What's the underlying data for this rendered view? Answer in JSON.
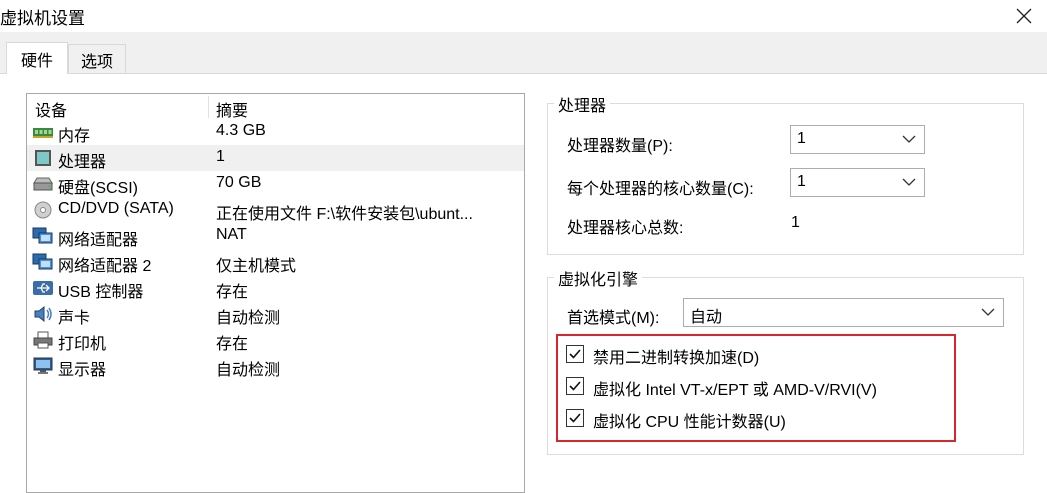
{
  "window": {
    "title": "虚拟机设置"
  },
  "tabs": [
    {
      "label": "硬件"
    },
    {
      "label": "选项"
    }
  ],
  "device_list": {
    "columns": [
      "设备",
      "摘要"
    ],
    "rows": [
      {
        "name": "内存",
        "summary": "4.3 GB",
        "icon": "memory-icon"
      },
      {
        "name": "处理器",
        "summary": "1",
        "icon": "processor-icon"
      },
      {
        "name": "硬盘(SCSI)",
        "summary": "70 GB",
        "icon": "hard-disk-icon"
      },
      {
        "name": "CD/DVD (SATA)",
        "summary": "正在使用文件 F:\\软件安装包\\ubunt...",
        "icon": "cd-dvd-icon"
      },
      {
        "name": "网络适配器",
        "summary": "NAT",
        "icon": "network-adapter-icon"
      },
      {
        "name": "网络适配器 2",
        "summary": "仅主机模式",
        "icon": "network-adapter-icon"
      },
      {
        "name": "USB 控制器",
        "summary": "存在",
        "icon": "usb-icon"
      },
      {
        "name": "声卡",
        "summary": "自动检测",
        "icon": "sound-card-icon"
      },
      {
        "name": "打印机",
        "summary": "存在",
        "icon": "printer-icon"
      },
      {
        "name": "显示器",
        "summary": "自动检测",
        "icon": "display-icon"
      }
    ],
    "selected_index": 1
  },
  "processor_group": {
    "title": "处理器",
    "num_processors_label": "处理器数量(P):",
    "num_processors_value": "1",
    "cores_label": "每个处理器的核心数量(C):",
    "cores_value": "1",
    "total_cores_label": "处理器核心总数:",
    "total_cores_value": "1"
  },
  "virtualization_group": {
    "title": "虚拟化引擎",
    "mode_label": "首选模式(M):",
    "mode_value": "自动",
    "options": [
      {
        "label": "禁用二进制转换加速(D)",
        "checked": true
      },
      {
        "label": "虚拟化 Intel VT-x/EPT 或 AMD-V/RVI(V)",
        "checked": true
      },
      {
        "label": "虚拟化 CPU 性能计数器(U)",
        "checked": true
      }
    ]
  },
  "colors": {
    "highlight_border": "#d9262c",
    "selected_row": "#f0f0f0",
    "tab_strip": "#f0f0f0"
  }
}
